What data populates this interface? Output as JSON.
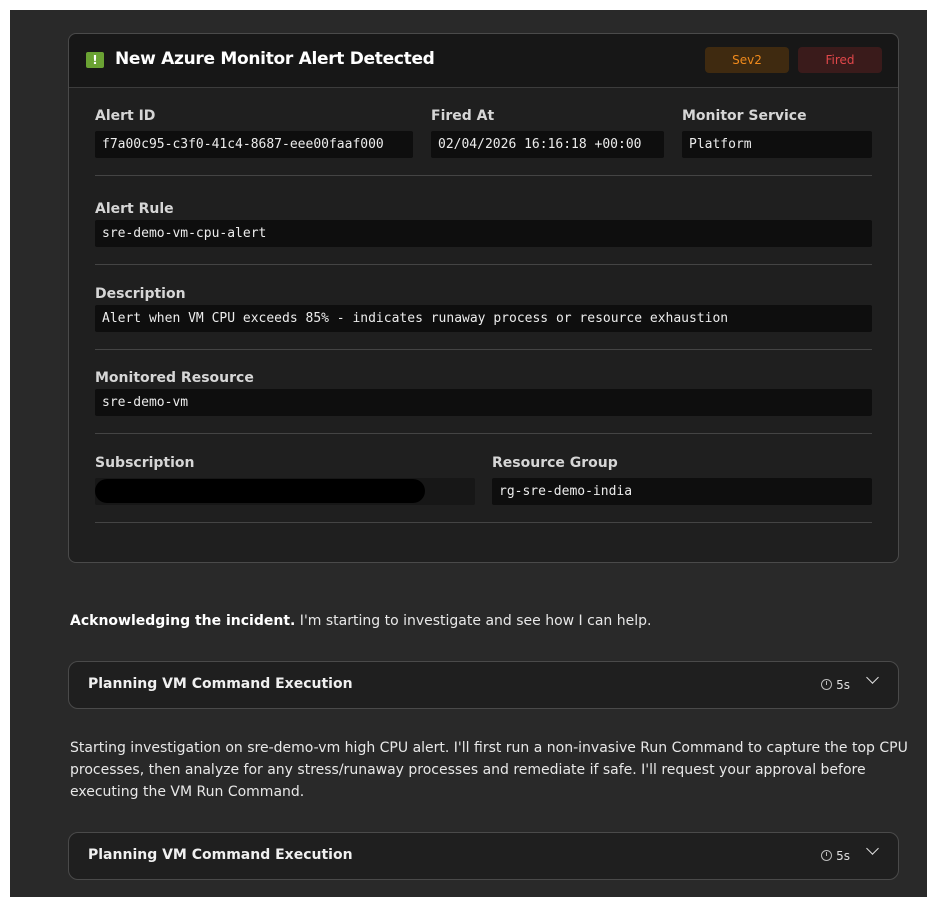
{
  "alert": {
    "title": "New Azure Monitor Alert Detected",
    "severity": "Sev2",
    "status": "Fired",
    "fields": {
      "alert_id_label": "Alert ID",
      "alert_id": "f7a00c95-c3f0-41c4-8687-eee00faaf000",
      "fired_at_label": "Fired At",
      "fired_at": "02/04/2026 16:16:18 +00:00",
      "monitor_service_label": "Monitor Service",
      "monitor_service": "Platform",
      "alert_rule_label": "Alert Rule",
      "alert_rule": "sre-demo-vm-cpu-alert",
      "description_label": "Description",
      "description": "Alert when VM CPU exceeds 85% - indicates runaway process or resource exhaustion",
      "monitored_resource_label": "Monitored Resource",
      "monitored_resource": "sre-demo-vm",
      "subscription_label": "Subscription",
      "resource_group_label": "Resource Group",
      "resource_group": "rg-sre-demo-india"
    }
  },
  "ack": {
    "bold": "Acknowledging the incident.",
    "rest": " I'm starting to investigate and see how I can help."
  },
  "steps": [
    {
      "title": "Planning VM Command Execution",
      "duration": "5s"
    },
    {
      "title": "Planning VM Command Execution",
      "duration": "5s"
    }
  ],
  "investigation_text": "Starting investigation on sre-demo-vm high CPU alert. I'll first run a non-invasive Run Command to capture the top CPU processes, then analyze for any stress/runaway processes and remediate if safe. I'll request your approval before executing the VM Run Command."
}
